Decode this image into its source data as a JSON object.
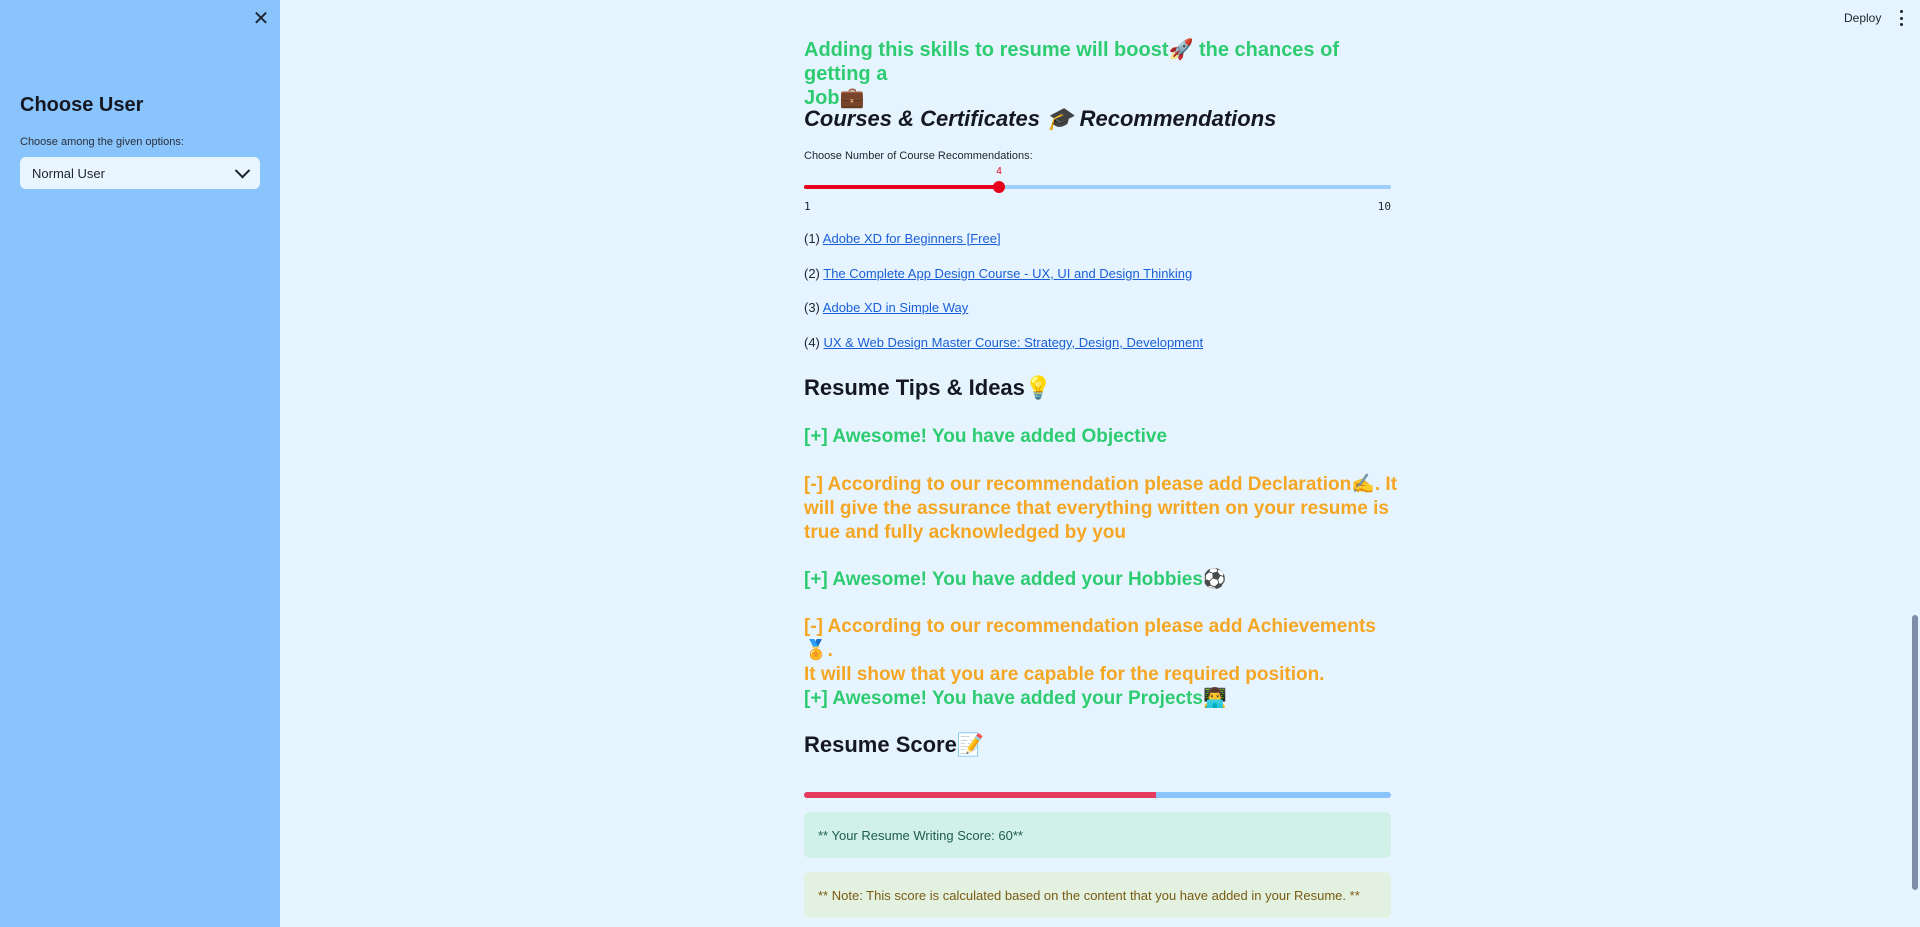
{
  "header": {
    "deploy_label": "Deploy"
  },
  "sidebar": {
    "title": "Choose User",
    "select_label": "Choose among the given options:",
    "select_value": "Normal User"
  },
  "skills_boost": {
    "line1": "Adding this skills to resume will boost🚀 the chances of getting a",
    "line2": "Job💼"
  },
  "courses": {
    "heading": "Courses & Certificates 🎓 Recommendations",
    "slider_label": "Choose Number of Course Recommendations:",
    "slider_min": "1",
    "slider_max": "10",
    "slider_value": "4",
    "slider_fraction": 0.333,
    "items": [
      {
        "num": "(1) ",
        "title": "Adobe XD for Beginners [Free]"
      },
      {
        "num": "(2) ",
        "title": "The Complete App Design Course - UX, UI and Design Thinking"
      },
      {
        "num": "(3) ",
        "title": "Adobe XD in Simple Way"
      },
      {
        "num": "(4) ",
        "title": "UX & Web Design Master Course: Strategy, Design, Development"
      }
    ]
  },
  "tips": {
    "heading": "Resume Tips & Ideas💡",
    "t1": "[+] Awesome! You have added Objective",
    "t2_l1": "[-] According to our recommendation please add Declaration✍️. It",
    "t2_l2": "will give the assurance that everything written on your resume is",
    "t2_l3": "true and fully acknowledged by you",
    "t3": "[+] Awesome! You have added your Hobbies⚽",
    "t4_l1": "[-] According to our recommendation please add Achievements🏅.",
    "t4_l2": "It will show that you are capable for the required position.",
    "t5": "[+] Awesome! You have added your Projects👨‍💻"
  },
  "score": {
    "heading": "Resume Score📝",
    "progress_fraction": 0.6,
    "score_text": "** Your Resume Writing Score: 60**",
    "note_text": "** Note: This score is calculated based on the content that you have added in your Resume. **"
  },
  "colors": {
    "sidebar_bg": "#89c4fc",
    "main_bg": "#e6f4ff",
    "positive": "#2ecc71",
    "warning": "#f5a623",
    "slider_red": "#e6001a",
    "progress_fill": "#e63a5f"
  }
}
